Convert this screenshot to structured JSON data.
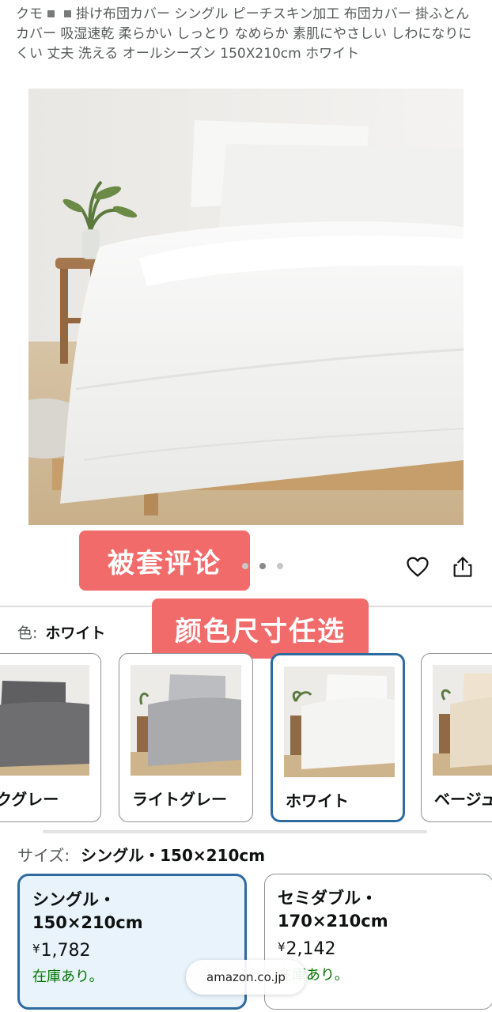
{
  "product": {
    "title_pre": "クモ",
    "title_post": "掛け布団カバー シングル ピーチスキン加工 布団カバー 掛ふとんカバー 吸湿速乾 柔らかい しっとり なめらか 素肌にやさしい しわになりにくい 丈夫 洗える オールシーズン 150X210cm ホワイト"
  },
  "overlays": {
    "review_tag": "被套评论",
    "options_tag": "颜色尺寸任选"
  },
  "gallery": {
    "dot_count": 3,
    "active_dot": 1
  },
  "color": {
    "key": "色:",
    "value": "ホワイト",
    "options": [
      {
        "label": "ダークグレー",
        "display": "ークグレー",
        "fill": "#6e6e70"
      },
      {
        "label": "ライトグレー",
        "display": "ライトグレー",
        "fill": "#a9aaad"
      },
      {
        "label": "ホワイト",
        "display": "ホワイト",
        "fill": "#f4f4f2",
        "selected": true
      },
      {
        "label": "ベージュ",
        "display": "ベージュ",
        "fill": "#e8dcc6"
      }
    ]
  },
  "size": {
    "key": "サイズ:",
    "value": "シングル・150×210cm",
    "options": [
      {
        "name_line1": "シングル・",
        "name_line2": "150×210cm",
        "currency": "¥",
        "price": "1,782",
        "stock": "在庫あり。",
        "selected": true
      },
      {
        "name_line1": "セミダブル・",
        "name_line2": "170×210cm",
        "currency": "¥",
        "price": "2,142",
        "stock": "在庫あり。",
        "selected": false
      }
    ]
  },
  "browser": {
    "domain": "amazon.co.jp"
  },
  "colors": {
    "accent": "#2d6a9f",
    "overlay": "#f26b6b",
    "stock": "#007600"
  }
}
